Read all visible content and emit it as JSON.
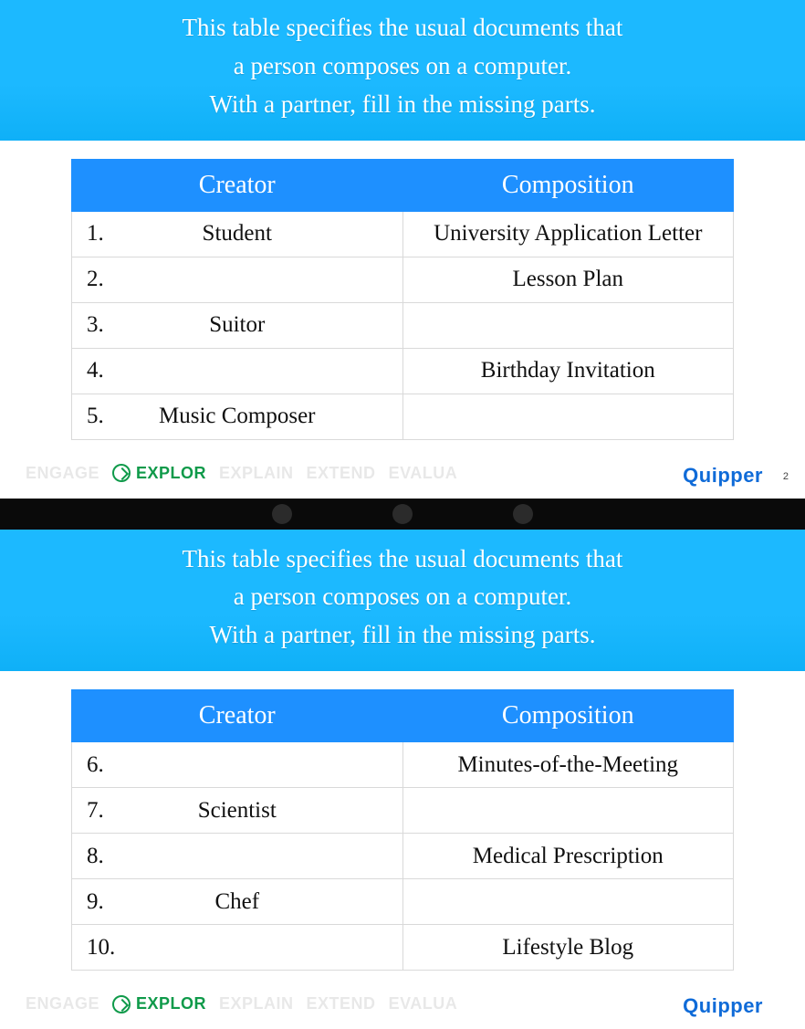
{
  "banner": {
    "line1": "This table specifies the usual documents that",
    "line2": "a person composes on a computer.",
    "line3": "With a partner, fill in the missing parts."
  },
  "table_headers": {
    "creator": "Creator",
    "composition": "Composition"
  },
  "slide1": {
    "rows": [
      {
        "n": "1.",
        "creator": "Student",
        "composition": "University Application Letter"
      },
      {
        "n": "2.",
        "creator": "",
        "composition": "Lesson Plan"
      },
      {
        "n": "3.",
        "creator": "Suitor",
        "composition": ""
      },
      {
        "n": "4.",
        "creator": "",
        "composition": "Birthday Invitation"
      },
      {
        "n": "5.",
        "creator": "Music Composer",
        "composition": ""
      }
    ],
    "page": "2"
  },
  "slide2": {
    "rows": [
      {
        "n": "6.",
        "creator": "",
        "composition": "Minutes-of-the-Meeting"
      },
      {
        "n": "7.",
        "creator": "Scientist",
        "composition": ""
      },
      {
        "n": "8.",
        "creator": "",
        "composition": "Medical Prescription"
      },
      {
        "n": "9.",
        "creator": "Chef",
        "composition": ""
      },
      {
        "n": "10.",
        "creator": "",
        "composition": "Lifestyle Blog"
      }
    ]
  },
  "nav": {
    "engage": "ENGAGE",
    "explore": "EXPLOR",
    "explain": "EXPLAIN",
    "extend": "EXTEND",
    "evaluate": "EVALUA",
    "brand": "Quipper"
  }
}
